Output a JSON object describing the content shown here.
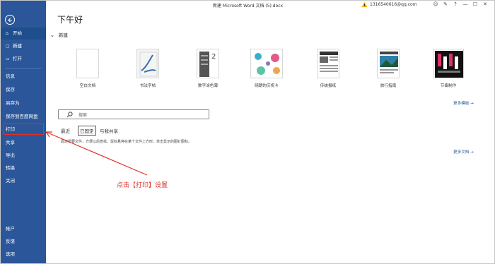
{
  "titlebar": {
    "document_title": "新建 Microsoft Word 文档 (5).docx",
    "account": "1316540616@qq.com",
    "icons": [
      "face-icon",
      "feedback-icon",
      "help-icon",
      "minimize-icon",
      "maximize-icon",
      "close-icon"
    ],
    "icon_glyphs": [
      "☺",
      "✎",
      "?",
      "—",
      "☐",
      "✕"
    ]
  },
  "sidebar": {
    "back_icon": "back-arrow-icon",
    "top_items": [
      {
        "label": "开始",
        "icon": "⌂"
      },
      {
        "label": "新建",
        "icon": "▢"
      },
      {
        "label": "打开",
        "icon": "▭"
      }
    ],
    "mid_items": [
      {
        "label": "信息"
      },
      {
        "label": "保存"
      },
      {
        "label": "另存为"
      },
      {
        "label": "保存到百度网盘"
      },
      {
        "label": "打印"
      },
      {
        "label": "共享"
      },
      {
        "label": "导出"
      },
      {
        "label": "转换"
      },
      {
        "label": "关闭"
      }
    ],
    "bottom_items": [
      {
        "label": "帐户"
      },
      {
        "label": "反馈"
      },
      {
        "label": "选项"
      }
    ],
    "colors": {
      "background": "#2b579a",
      "active": "#1e4e8c"
    }
  },
  "main": {
    "greeting": "下午好",
    "new_section_title": "新建",
    "templates": [
      {
        "label": "空白文档"
      },
      {
        "label": "书法字帖"
      },
      {
        "label": "数字涂色薄"
      },
      {
        "label": "晴朗的庆祝卡"
      },
      {
        "label": "传统报纸"
      },
      {
        "label": "旅行指南"
      },
      {
        "label": "节奏制作"
      }
    ],
    "more_templates": "更多模板 →",
    "search_placeholder": "搜索",
    "tabs": [
      {
        "label": "最近"
      },
      {
        "label": "已固定"
      },
      {
        "label": "与我共享"
      }
    ],
    "empty_message": "固定需要文件，方便以后查找。鼠标悬停在某个文件上方时，单击显示的图钉图标。",
    "more_documents": "更多文档 →"
  },
  "annotation": {
    "text": "点击【打印】设置",
    "color": "#e0302a"
  }
}
